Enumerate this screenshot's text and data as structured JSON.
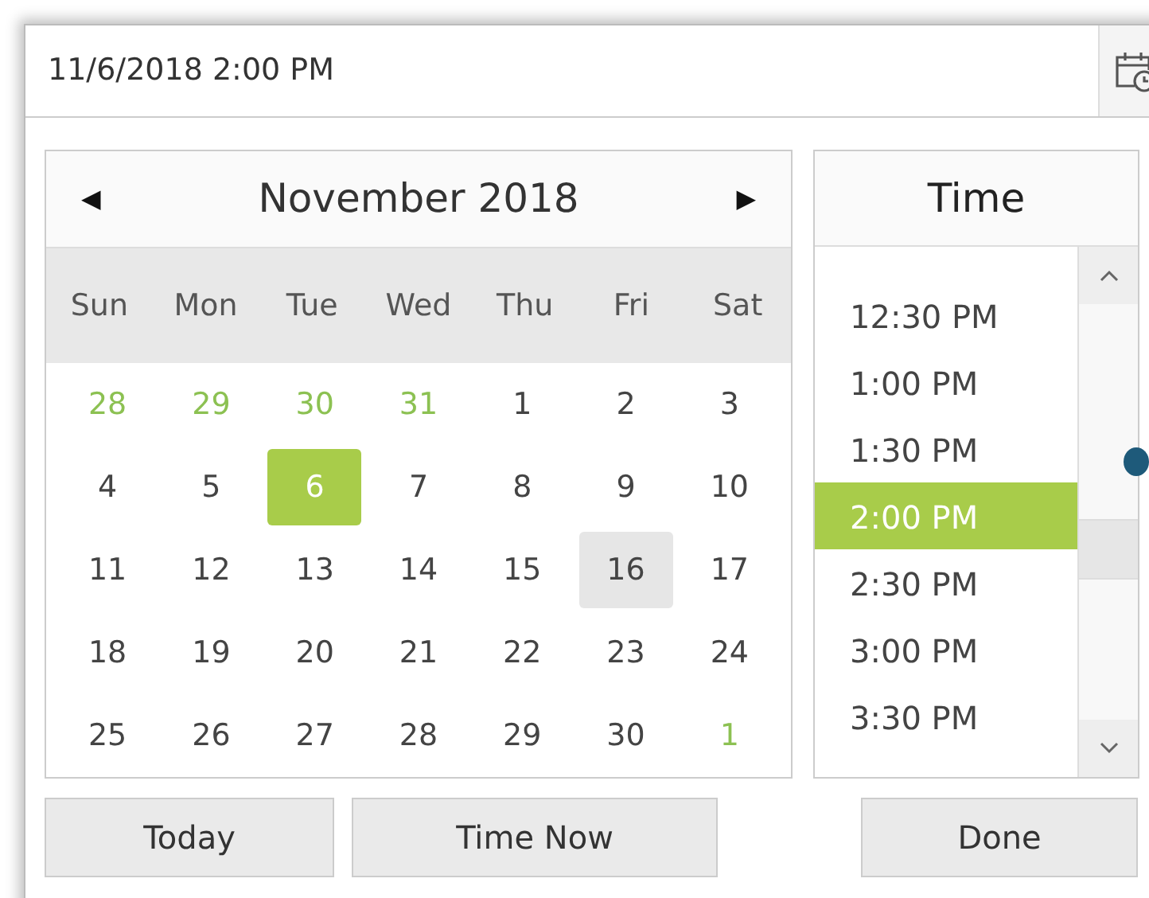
{
  "input": {
    "value": "11/6/2018 2:00 PM"
  },
  "calendar": {
    "title": "November 2018",
    "prev": "◀",
    "next": "▶",
    "weekdays": [
      "Sun",
      "Mon",
      "Tue",
      "Wed",
      "Thu",
      "Fri",
      "Sat"
    ],
    "weeks": [
      [
        {
          "day": "28",
          "kind": "other",
          "selected": false,
          "highlighted": false
        },
        {
          "day": "29",
          "kind": "other",
          "selected": false,
          "highlighted": false
        },
        {
          "day": "30",
          "kind": "other",
          "selected": false,
          "highlighted": false
        },
        {
          "day": "31",
          "kind": "other",
          "selected": false,
          "highlighted": false
        },
        {
          "day": "1",
          "kind": "current",
          "selected": false,
          "highlighted": false
        },
        {
          "day": "2",
          "kind": "current",
          "selected": false,
          "highlighted": false
        },
        {
          "day": "3",
          "kind": "current",
          "selected": false,
          "highlighted": false
        }
      ],
      [
        {
          "day": "4",
          "kind": "current",
          "selected": false,
          "highlighted": false
        },
        {
          "day": "5",
          "kind": "current",
          "selected": false,
          "highlighted": false
        },
        {
          "day": "6",
          "kind": "current",
          "selected": true,
          "highlighted": false
        },
        {
          "day": "7",
          "kind": "current",
          "selected": false,
          "highlighted": false
        },
        {
          "day": "8",
          "kind": "current",
          "selected": false,
          "highlighted": false
        },
        {
          "day": "9",
          "kind": "current",
          "selected": false,
          "highlighted": false
        },
        {
          "day": "10",
          "kind": "current",
          "selected": false,
          "highlighted": false
        }
      ],
      [
        {
          "day": "11",
          "kind": "current",
          "selected": false,
          "highlighted": false
        },
        {
          "day": "12",
          "kind": "current",
          "selected": false,
          "highlighted": false
        },
        {
          "day": "13",
          "kind": "current",
          "selected": false,
          "highlighted": false
        },
        {
          "day": "14",
          "kind": "current",
          "selected": false,
          "highlighted": false
        },
        {
          "day": "15",
          "kind": "current",
          "selected": false,
          "highlighted": false
        },
        {
          "day": "16",
          "kind": "current",
          "selected": false,
          "highlighted": true
        },
        {
          "day": "17",
          "kind": "current",
          "selected": false,
          "highlighted": false
        }
      ],
      [
        {
          "day": "18",
          "kind": "current",
          "selected": false,
          "highlighted": false
        },
        {
          "day": "19",
          "kind": "current",
          "selected": false,
          "highlighted": false
        },
        {
          "day": "20",
          "kind": "current",
          "selected": false,
          "highlighted": false
        },
        {
          "day": "21",
          "kind": "current",
          "selected": false,
          "highlighted": false
        },
        {
          "day": "22",
          "kind": "current",
          "selected": false,
          "highlighted": false
        },
        {
          "day": "23",
          "kind": "current",
          "selected": false,
          "highlighted": false
        },
        {
          "day": "24",
          "kind": "current",
          "selected": false,
          "highlighted": false
        }
      ],
      [
        {
          "day": "25",
          "kind": "current",
          "selected": false,
          "highlighted": false
        },
        {
          "day": "26",
          "kind": "current",
          "selected": false,
          "highlighted": false
        },
        {
          "day": "27",
          "kind": "current",
          "selected": false,
          "highlighted": false
        },
        {
          "day": "28",
          "kind": "current",
          "selected": false,
          "highlighted": false
        },
        {
          "day": "29",
          "kind": "current",
          "selected": false,
          "highlighted": false
        },
        {
          "day": "30",
          "kind": "current",
          "selected": false,
          "highlighted": false
        },
        {
          "day": "1",
          "kind": "other",
          "selected": false,
          "highlighted": false
        }
      ]
    ]
  },
  "time": {
    "title": "Time",
    "items": [
      {
        "label": "12:30 PM",
        "selected": false
      },
      {
        "label": "1:00 PM",
        "selected": false
      },
      {
        "label": "1:30 PM",
        "selected": false
      },
      {
        "label": "2:00 PM",
        "selected": true
      },
      {
        "label": "2:30 PM",
        "selected": false
      },
      {
        "label": "3:00 PM",
        "selected": false
      },
      {
        "label": "3:30 PM",
        "selected": false
      }
    ]
  },
  "buttons": [
    {
      "label": "Today",
      "kind": "today"
    },
    {
      "label": "Time Now",
      "kind": "now"
    },
    {
      "label": "Done",
      "kind": "done"
    }
  ]
}
